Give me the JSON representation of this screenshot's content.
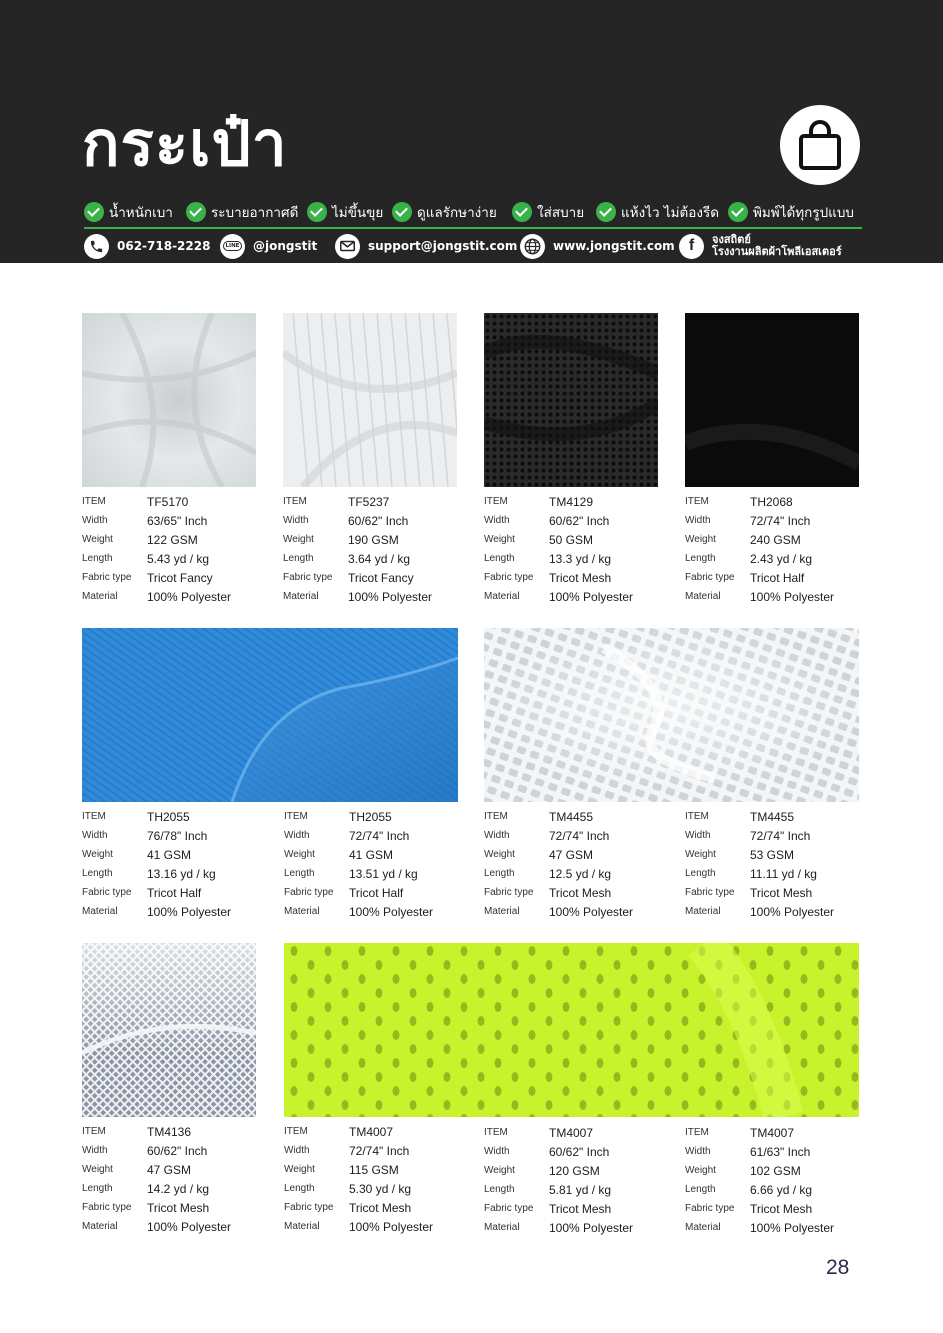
{
  "header": {
    "title": "กระเป๋า",
    "icon": "shopping-bag-icon",
    "accent_color": "#39b24a",
    "background_color": "#252525",
    "features": [
      "น้ำหนักเบา",
      "ระบายอากาศดี",
      "ไม่ขึ้นขุย",
      "ดูแลรักษาง่าย",
      "ใส่สบาย",
      "แห้งไว ไม่ต้องรีด",
      "พิมพ์ได้ทุกรูปแบบ"
    ],
    "contacts": {
      "phone": "062-718-2228",
      "line": "@jongstit",
      "line_badge": "LINE",
      "email": "support@jongstit.com",
      "website": "www.jongstit.com",
      "facebook_line1": "จงสถิตย์",
      "facebook_line2": "โรงงานผลิตผ้าโพลีเอสเตอร์"
    }
  },
  "spec_labels": {
    "item": "ITEM",
    "width": "Width",
    "weight": "Weight",
    "length": "Length",
    "fabric_type": "Fabric type",
    "material": "Material"
  },
  "products": [
    {
      "item": "TF5170",
      "width": "63/65\" Inch",
      "weight": "122 GSM",
      "length": "5.43 yd / kg",
      "fabric_type": "Tricot Fancy",
      "material": "100% Polyester",
      "swatch_color": "#dfe3e6"
    },
    {
      "item": "TF5237",
      "width": "60/62\" Inch",
      "weight": "190 GSM",
      "length": "3.64 yd / kg",
      "fabric_type": "Tricot Fancy",
      "material": "100% Polyester",
      "swatch_color": "#eef0f1"
    },
    {
      "item": "TM4129",
      "width": "60/62\" Inch",
      "weight": "50 GSM",
      "length": "13.3 yd / kg",
      "fabric_type": "Tricot Mesh",
      "material": "100% Polyester",
      "swatch_color": "#1c1c1c"
    },
    {
      "item": "TH2068",
      "width": "72/74\" Inch",
      "weight": "240 GSM",
      "length": "2.43 yd / kg",
      "fabric_type": "Tricot Half",
      "material": "100% Polyester",
      "swatch_color": "#0c0c0c"
    },
    {
      "item": "TH2055",
      "width": "76/78\" Inch",
      "weight": "41 GSM",
      "length": "13.16 yd / kg",
      "fabric_type": "Tricot Half",
      "material": "100% Polyester",
      "swatch_color": "#2d86d6"
    },
    {
      "item": "TH2055",
      "width": "72/74\" Inch",
      "weight": "41 GSM",
      "length": "13.51 yd / kg",
      "fabric_type": "Tricot Half",
      "material": "100% Polyester",
      "swatch_color": "#2d86d6"
    },
    {
      "item": "TM4455",
      "width": "72/74\" Inch",
      "weight": "47 GSM",
      "length": "12.5 yd / kg",
      "fabric_type": "Tricot Mesh",
      "material": "100% Polyester",
      "swatch_color": "#e8ecef"
    },
    {
      "item": "TM4455",
      "width": "72/74\" Inch",
      "weight": "53 GSM",
      "length": "11.11 yd / kg",
      "fabric_type": "Tricot Mesh",
      "material": "100% Polyester",
      "swatch_color": "#e8ecef"
    },
    {
      "item": "TM4136",
      "width": "60/62\" Inch",
      "weight": "47 GSM",
      "length": "14.2 yd / kg",
      "fabric_type": "Tricot Mesh",
      "material": "100% Polyester",
      "swatch_color": "#c9ced6"
    },
    {
      "item": "TM4007",
      "width": "72/74\" Inch",
      "weight": "115 GSM",
      "length": "5.30 yd / kg",
      "fabric_type": "Tricot  Mesh",
      "material": "100% Polyester",
      "swatch_color": "#c6f22a"
    },
    {
      "item": "TM4007",
      "width": "60/62\" Inch",
      "weight": "120 GSM",
      "length": "5.81 yd / kg",
      "fabric_type": "Tricot  Mesh",
      "material": "100% Polyester",
      "swatch_color": "#c6f22a"
    },
    {
      "item": "TM4007",
      "width": "61/63\" Inch",
      "weight": "102 GSM",
      "length": "6.66 yd / kg",
      "fabric_type": "Tricot  Mesh",
      "material": "100% Polyester",
      "swatch_color": "#c6f22a"
    }
  ],
  "page_number": "28"
}
